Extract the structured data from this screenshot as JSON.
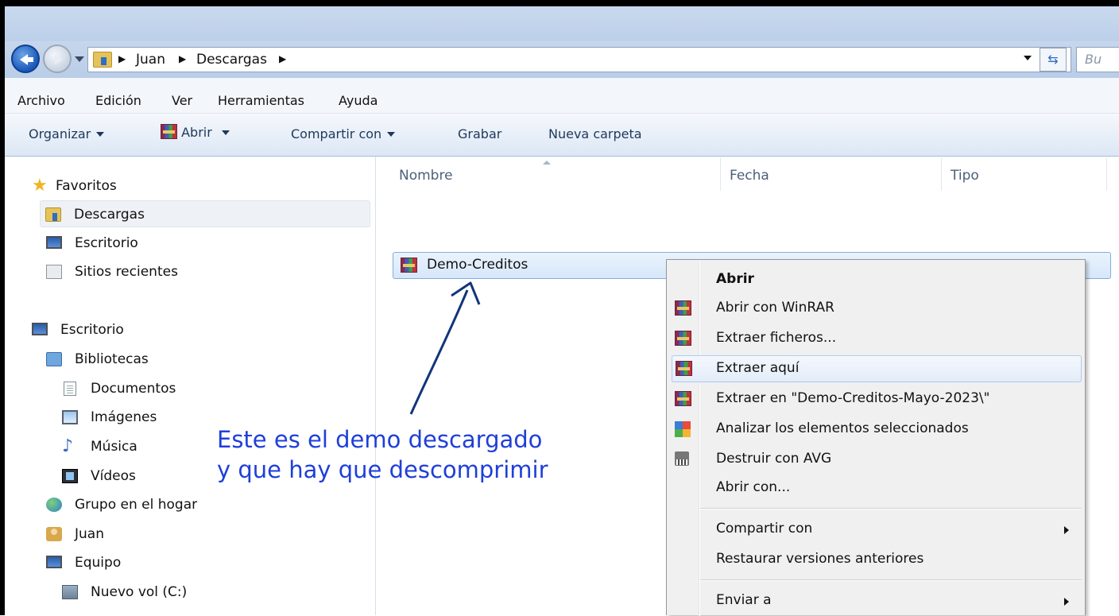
{
  "address": {
    "crumbs": [
      "Juan",
      "Descargas"
    ],
    "search_placeholder": "Bu"
  },
  "menubar": [
    "Archivo",
    "Edición",
    "Ver",
    "Herramientas",
    "Ayuda"
  ],
  "toolbar": {
    "organize": "Organizar",
    "open": "Abrir",
    "share": "Compartir con",
    "burn": "Grabar",
    "new_folder": "Nueva carpeta"
  },
  "nav": {
    "favorites": "Favoritos",
    "downloads": "Descargas",
    "desktop_fav": "Escritorio",
    "recent": "Sitios recientes",
    "desktop": "Escritorio",
    "libraries": "Bibliotecas",
    "documents": "Documentos",
    "images": "Imágenes",
    "music": "Música",
    "videos": "Vídeos",
    "homegroup": "Grupo en el hogar",
    "user": "Juan",
    "computer": "Equipo",
    "drive_c": "Nuevo vol (C:)"
  },
  "columns": {
    "name": "Nombre",
    "date": "Fecha",
    "type": "Tipo"
  },
  "file": {
    "name": "Demo-Creditos",
    "icon": "winrar-archive-icon"
  },
  "annotation": {
    "line1": "Este es el demo descargado",
    "line2": "y que hay que descomprimir",
    "color": "#1f3fd8"
  },
  "context_menu": {
    "open": "Abrir",
    "open_winrar": "Abrir con WinRAR",
    "extract_files": "Extraer ficheros...",
    "extract_here": "Extraer aquí",
    "extract_to": "Extraer en \"Demo-Creditos-Mayo-2023\\\"",
    "scan": "Analizar los elementos seleccionados",
    "shred": "Destruir con AVG",
    "open_with": "Abrir con...",
    "share_with": "Compartir con",
    "restore": "Restaurar versiones anteriores",
    "send_to": "Enviar a"
  },
  "colors": {
    "toolbar_text": "#1e395b",
    "selection_border": "#84acdd",
    "annotation": "#1f3fd8"
  }
}
